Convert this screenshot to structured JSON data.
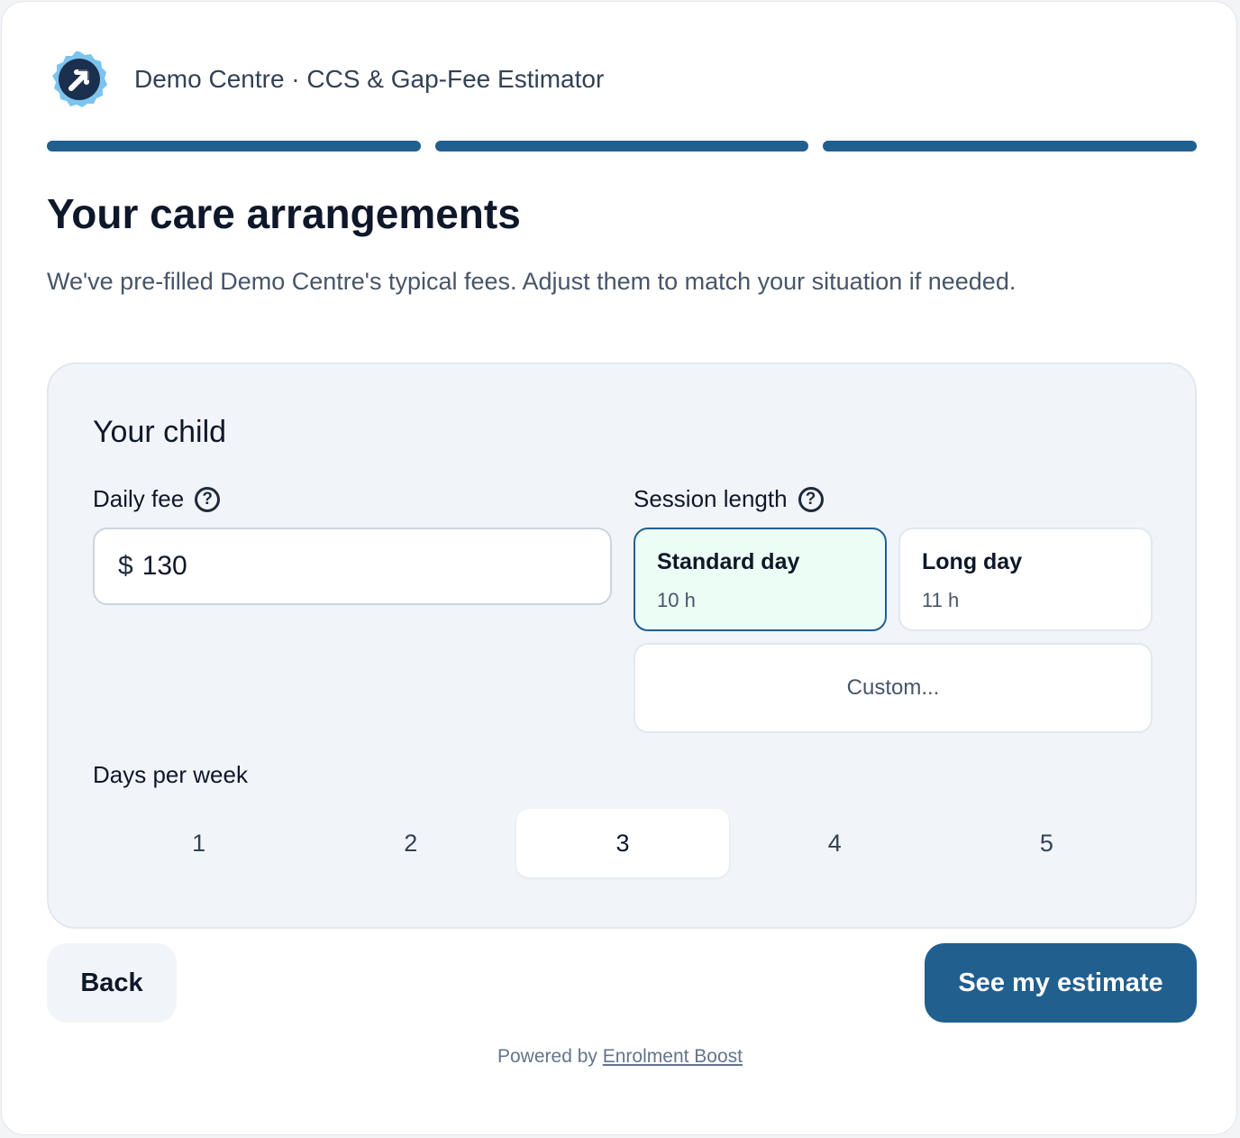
{
  "header": {
    "logo_icon": "arrow-up-right-badge-icon",
    "title": "Demo Centre · CCS & Gap-Fee Estimator"
  },
  "progress": {
    "total_steps": 3,
    "completed_steps": 3,
    "color": "#215f8f"
  },
  "page": {
    "title": "Your care arrangements",
    "subtitle": "We've pre-filled Demo Centre's typical fees. Adjust them to match your situation if needed."
  },
  "child": {
    "section_title": "Your child",
    "daily_fee": {
      "label": "Daily fee",
      "currency_symbol": "$",
      "value": "130"
    },
    "session_length": {
      "label": "Session length",
      "options": [
        {
          "label": "Standard day",
          "sub": "10 h",
          "selected": true
        },
        {
          "label": "Long day",
          "sub": "11 h",
          "selected": false
        }
      ],
      "custom_label": "Custom..."
    },
    "days_per_week": {
      "label": "Days per week",
      "options": [
        "1",
        "2",
        "3",
        "4",
        "5"
      ],
      "selected": "3"
    }
  },
  "actions": {
    "back_label": "Back",
    "estimate_label": "See my estimate"
  },
  "footer": {
    "prefix": "Powered by",
    "link_text": "Enrolment Boost"
  },
  "colors": {
    "accent": "#215f8f",
    "selected_bg": "#ecfdf5",
    "panel_bg": "#f1f5f9"
  }
}
